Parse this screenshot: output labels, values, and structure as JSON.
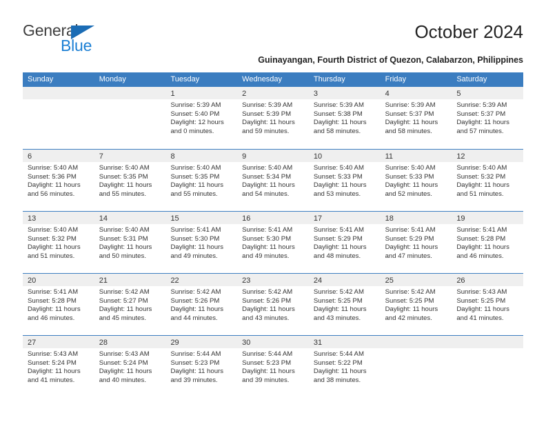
{
  "brand": {
    "name_part1": "General",
    "name_part2": "Blue"
  },
  "header": {
    "title": "October 2024",
    "subtitle": "Guinayangan, Fourth District of Quezon, Calabarzon, Philippines"
  },
  "calendar": {
    "day_headers": [
      "Sunday",
      "Monday",
      "Tuesday",
      "Wednesday",
      "Thursday",
      "Friday",
      "Saturday"
    ],
    "accent_color": "#3b7dc0",
    "day_strip_color": "#efefef",
    "weeks": [
      [
        {
          "day": "",
          "lines": []
        },
        {
          "day": "",
          "lines": []
        },
        {
          "day": "1",
          "lines": [
            "Sunrise: 5:39 AM",
            "Sunset: 5:40 PM",
            "Daylight: 12 hours",
            "and 0 minutes."
          ]
        },
        {
          "day": "2",
          "lines": [
            "Sunrise: 5:39 AM",
            "Sunset: 5:39 PM",
            "Daylight: 11 hours",
            "and 59 minutes."
          ]
        },
        {
          "day": "3",
          "lines": [
            "Sunrise: 5:39 AM",
            "Sunset: 5:38 PM",
            "Daylight: 11 hours",
            "and 58 minutes."
          ]
        },
        {
          "day": "4",
          "lines": [
            "Sunrise: 5:39 AM",
            "Sunset: 5:37 PM",
            "Daylight: 11 hours",
            "and 58 minutes."
          ]
        },
        {
          "day": "5",
          "lines": [
            "Sunrise: 5:39 AM",
            "Sunset: 5:37 PM",
            "Daylight: 11 hours",
            "and 57 minutes."
          ]
        }
      ],
      [
        {
          "day": "6",
          "lines": [
            "Sunrise: 5:40 AM",
            "Sunset: 5:36 PM",
            "Daylight: 11 hours",
            "and 56 minutes."
          ]
        },
        {
          "day": "7",
          "lines": [
            "Sunrise: 5:40 AM",
            "Sunset: 5:35 PM",
            "Daylight: 11 hours",
            "and 55 minutes."
          ]
        },
        {
          "day": "8",
          "lines": [
            "Sunrise: 5:40 AM",
            "Sunset: 5:35 PM",
            "Daylight: 11 hours",
            "and 55 minutes."
          ]
        },
        {
          "day": "9",
          "lines": [
            "Sunrise: 5:40 AM",
            "Sunset: 5:34 PM",
            "Daylight: 11 hours",
            "and 54 minutes."
          ]
        },
        {
          "day": "10",
          "lines": [
            "Sunrise: 5:40 AM",
            "Sunset: 5:33 PM",
            "Daylight: 11 hours",
            "and 53 minutes."
          ]
        },
        {
          "day": "11",
          "lines": [
            "Sunrise: 5:40 AM",
            "Sunset: 5:33 PM",
            "Daylight: 11 hours",
            "and 52 minutes."
          ]
        },
        {
          "day": "12",
          "lines": [
            "Sunrise: 5:40 AM",
            "Sunset: 5:32 PM",
            "Daylight: 11 hours",
            "and 51 minutes."
          ]
        }
      ],
      [
        {
          "day": "13",
          "lines": [
            "Sunrise: 5:40 AM",
            "Sunset: 5:32 PM",
            "Daylight: 11 hours",
            "and 51 minutes."
          ]
        },
        {
          "day": "14",
          "lines": [
            "Sunrise: 5:40 AM",
            "Sunset: 5:31 PM",
            "Daylight: 11 hours",
            "and 50 minutes."
          ]
        },
        {
          "day": "15",
          "lines": [
            "Sunrise: 5:41 AM",
            "Sunset: 5:30 PM",
            "Daylight: 11 hours",
            "and 49 minutes."
          ]
        },
        {
          "day": "16",
          "lines": [
            "Sunrise: 5:41 AM",
            "Sunset: 5:30 PM",
            "Daylight: 11 hours",
            "and 49 minutes."
          ]
        },
        {
          "day": "17",
          "lines": [
            "Sunrise: 5:41 AM",
            "Sunset: 5:29 PM",
            "Daylight: 11 hours",
            "and 48 minutes."
          ]
        },
        {
          "day": "18",
          "lines": [
            "Sunrise: 5:41 AM",
            "Sunset: 5:29 PM",
            "Daylight: 11 hours",
            "and 47 minutes."
          ]
        },
        {
          "day": "19",
          "lines": [
            "Sunrise: 5:41 AM",
            "Sunset: 5:28 PM",
            "Daylight: 11 hours",
            "and 46 minutes."
          ]
        }
      ],
      [
        {
          "day": "20",
          "lines": [
            "Sunrise: 5:41 AM",
            "Sunset: 5:28 PM",
            "Daylight: 11 hours",
            "and 46 minutes."
          ]
        },
        {
          "day": "21",
          "lines": [
            "Sunrise: 5:42 AM",
            "Sunset: 5:27 PM",
            "Daylight: 11 hours",
            "and 45 minutes."
          ]
        },
        {
          "day": "22",
          "lines": [
            "Sunrise: 5:42 AM",
            "Sunset: 5:26 PM",
            "Daylight: 11 hours",
            "and 44 minutes."
          ]
        },
        {
          "day": "23",
          "lines": [
            "Sunrise: 5:42 AM",
            "Sunset: 5:26 PM",
            "Daylight: 11 hours",
            "and 43 minutes."
          ]
        },
        {
          "day": "24",
          "lines": [
            "Sunrise: 5:42 AM",
            "Sunset: 5:25 PM",
            "Daylight: 11 hours",
            "and 43 minutes."
          ]
        },
        {
          "day": "25",
          "lines": [
            "Sunrise: 5:42 AM",
            "Sunset: 5:25 PM",
            "Daylight: 11 hours",
            "and 42 minutes."
          ]
        },
        {
          "day": "26",
          "lines": [
            "Sunrise: 5:43 AM",
            "Sunset: 5:25 PM",
            "Daylight: 11 hours",
            "and 41 minutes."
          ]
        }
      ],
      [
        {
          "day": "27",
          "lines": [
            "Sunrise: 5:43 AM",
            "Sunset: 5:24 PM",
            "Daylight: 11 hours",
            "and 41 minutes."
          ]
        },
        {
          "day": "28",
          "lines": [
            "Sunrise: 5:43 AM",
            "Sunset: 5:24 PM",
            "Daylight: 11 hours",
            "and 40 minutes."
          ]
        },
        {
          "day": "29",
          "lines": [
            "Sunrise: 5:44 AM",
            "Sunset: 5:23 PM",
            "Daylight: 11 hours",
            "and 39 minutes."
          ]
        },
        {
          "day": "30",
          "lines": [
            "Sunrise: 5:44 AM",
            "Sunset: 5:23 PM",
            "Daylight: 11 hours",
            "and 39 minutes."
          ]
        },
        {
          "day": "31",
          "lines": [
            "Sunrise: 5:44 AM",
            "Sunset: 5:22 PM",
            "Daylight: 11 hours",
            "and 38 minutes."
          ]
        },
        {
          "day": "",
          "lines": []
        },
        {
          "day": "",
          "lines": []
        }
      ]
    ]
  }
}
